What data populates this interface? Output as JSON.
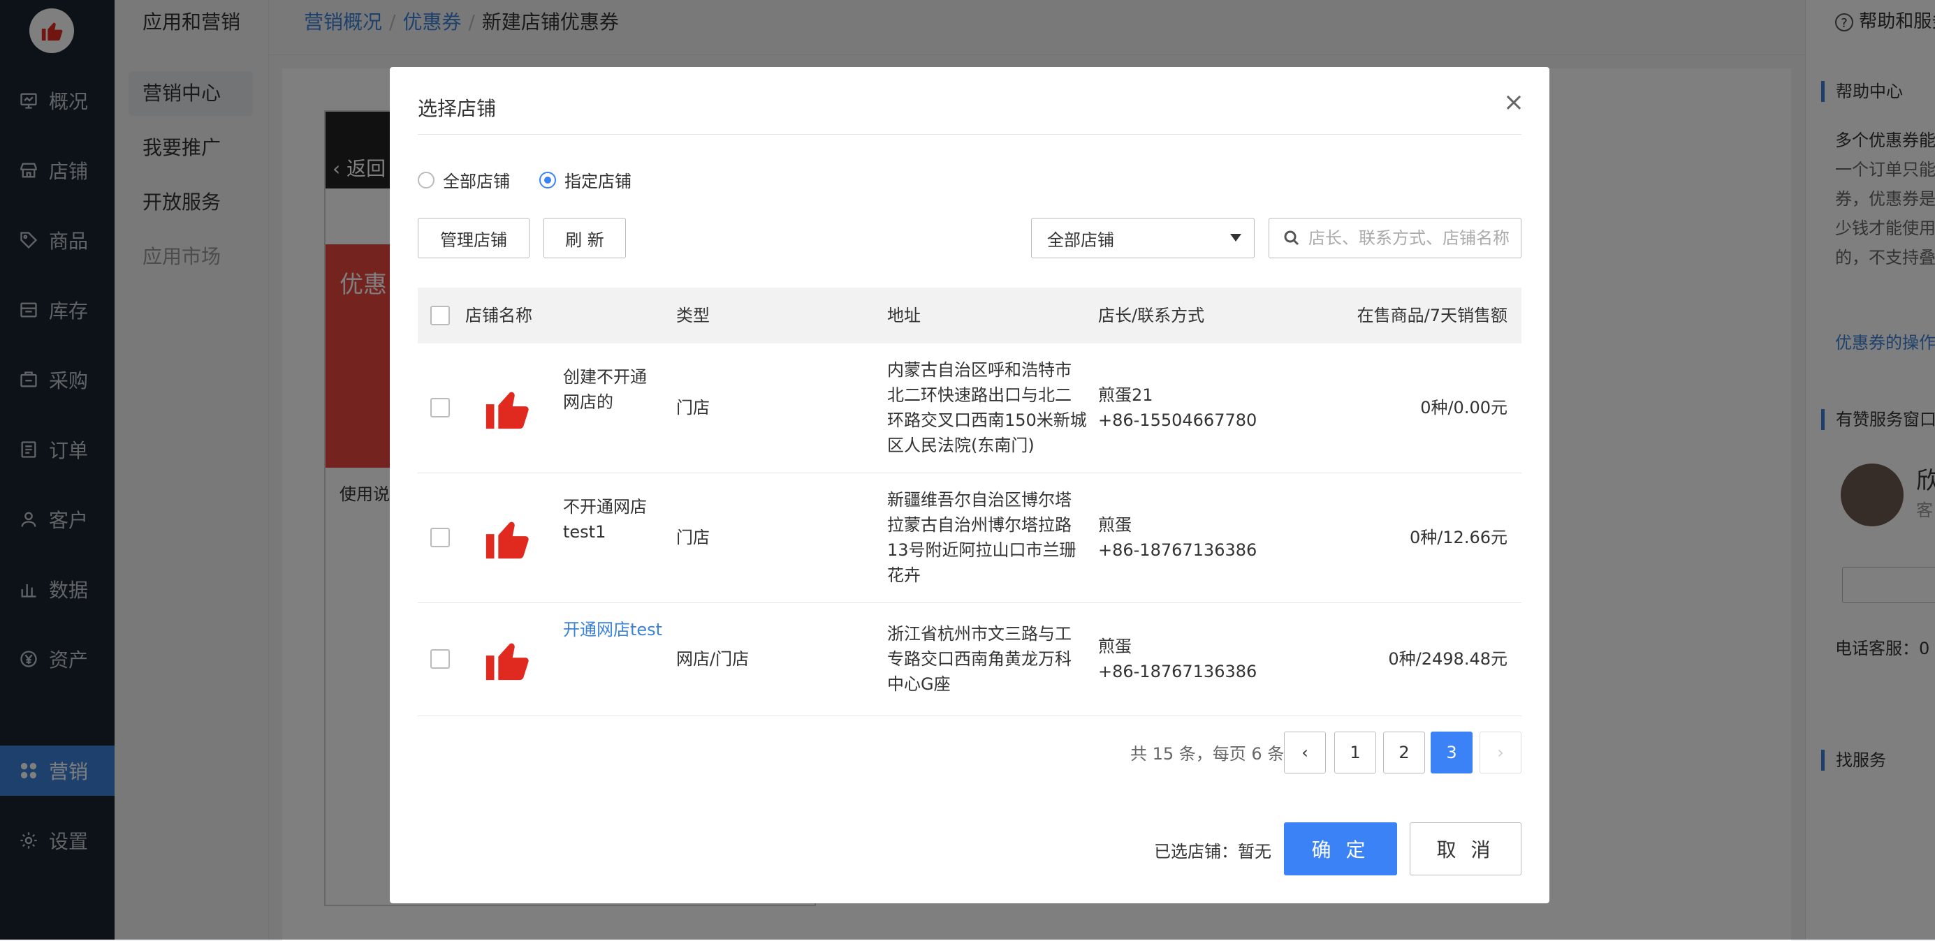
{
  "colors": {
    "accent": "#3b82f6",
    "link": "#3b82d9",
    "sidebar_bg": "#1b2530",
    "thumb_red": "#e02a20"
  },
  "sidebar": {
    "logo_icon": "thumbs-up-icon",
    "items": [
      {
        "label": "概况",
        "icon": "monitor-icon"
      },
      {
        "label": "店铺",
        "icon": "store-icon"
      },
      {
        "label": "商品",
        "icon": "tag-icon"
      },
      {
        "label": "库存",
        "icon": "inventory-icon"
      },
      {
        "label": "采购",
        "icon": "purchase-icon"
      },
      {
        "label": "订单",
        "icon": "order-icon"
      },
      {
        "label": "客户",
        "icon": "user-icon"
      },
      {
        "label": "数据",
        "icon": "chart-icon"
      },
      {
        "label": "资产",
        "icon": "yen-icon"
      },
      {
        "label": "营销",
        "icon": "grid-icon",
        "active": true
      },
      {
        "label": "设置",
        "icon": "gear-icon"
      }
    ]
  },
  "subnav": {
    "title": "应用和营销",
    "items": [
      "营销中心",
      "我要推广",
      "开放服务",
      "应用市场"
    ]
  },
  "header": {
    "breadcrumb": [
      "营销概况",
      "优惠券",
      "新建店铺优惠券"
    ]
  },
  "background_page": {
    "phone_back": "返回",
    "coupon_label": "优惠",
    "usage_label": "使用说"
  },
  "help": {
    "top_link": "帮助和服务",
    "section1": "帮助中心",
    "lines": [
      "多个优惠券能",
      "一个订单只能",
      "券，优惠券是",
      "少钱才能使用",
      "的，不支持叠"
    ],
    "link": "优惠券的操作",
    "section2": "有赞服务窗口",
    "agent_name": "欣",
    "agent_sub": "客",
    "phone_label": "电话客服：0",
    "section3": "找服务"
  },
  "modal": {
    "title": "选择店铺",
    "radio_all": "全部店铺",
    "radio_specific": "指定店铺",
    "manage_button": "管理店铺",
    "refresh_button": "刷 新",
    "filter_value": "全部店铺",
    "search_placeholder": "店长、联系方式、店铺名称",
    "columns": [
      "店铺名称",
      "类型",
      "地址",
      "店长/联系方式",
      "在售商品/7天销售额"
    ],
    "rows": [
      {
        "name": [
          "创建不开通",
          "网店的"
        ],
        "type": "门店",
        "address": [
          "内蒙古自治区呼和浩特市",
          "北二环快速路出口与北二",
          "环路交叉口西南150米新城",
          "区人民法院(东南门)"
        ],
        "manager": "煎蛋21",
        "phone": "+86-15504667780",
        "sales": "0种/0.00元"
      },
      {
        "name": [
          "不开通网店",
          "test1"
        ],
        "type": "门店",
        "address": [
          "新疆维吾尔自治区博尔塔",
          "拉蒙古自治州博尔塔拉路",
          "13号附近阿拉山口市兰珊",
          "花卉"
        ],
        "manager": "煎蛋",
        "phone": "+86-18767136386",
        "sales": "0种/12.66元"
      },
      {
        "name": [
          "开通网店test"
        ],
        "type": "网店/门店",
        "address": [
          "浙江省杭州市文三路与工",
          "专路交口西南角黄龙万科",
          "中心G座"
        ],
        "manager": "煎蛋",
        "phone": "+86-18767136386",
        "sales": "0种/2498.48元"
      }
    ],
    "pagination": {
      "total_text": "共 15 条，每页 6 条",
      "pages": [
        "1",
        "2",
        "3"
      ],
      "current": "3"
    },
    "selected_label": "已选店铺：暂无",
    "ok_button": "确 定",
    "cancel_button": "取 消"
  }
}
